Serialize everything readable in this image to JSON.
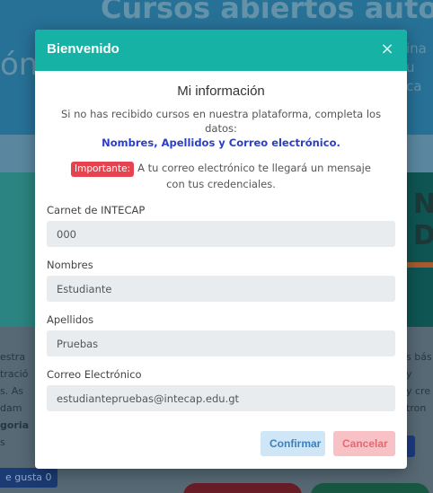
{
  "background": {
    "hero_title": "Cursos abiertos autogestio",
    "hero_side_left": "ón",
    "hero_side_right_line1": "ina",
    "hero_side_right_line2": "u ca",
    "lower_left_lines": [
      "estra",
      "tració",
      "s. As",
      "dam",
      "goria",
      "s"
    ],
    "lower_right_lines": [
      "s bás",
      "y",
      "y cre",
      "tron"
    ],
    "like_label": "e gusta 0"
  },
  "modal": {
    "title": "Bienvenido",
    "close_glyph": "×",
    "heading": "Mi información",
    "intro": "Si no has recibido cursos en nuestra plataforma, completa los datos:",
    "required_fields": "Nombres, Apellidos y Correo electrónico.",
    "notice_badge": "Importante:",
    "notice_text": "A tu correo electrónico te llegará un mensaje con tus credenciales.",
    "fields": [
      {
        "label": "Carnet de INTECAP",
        "value": "000"
      },
      {
        "label": "Nombres",
        "value": "Estudiante"
      },
      {
        "label": "Apellidos",
        "value": "Pruebas"
      },
      {
        "label": "Correo Electrónico",
        "value": "estudiantepruebas@intecap.edu.gt"
      }
    ],
    "confirm_label": "Confirmar",
    "cancel_label": "Cancelar"
  },
  "colors": {
    "header": "#17b2a6",
    "badge": "#e5434f",
    "required_text": "#2b3fc4",
    "confirm_bg": "#cfe6f7",
    "cancel_bg": "#f7c1c6"
  }
}
